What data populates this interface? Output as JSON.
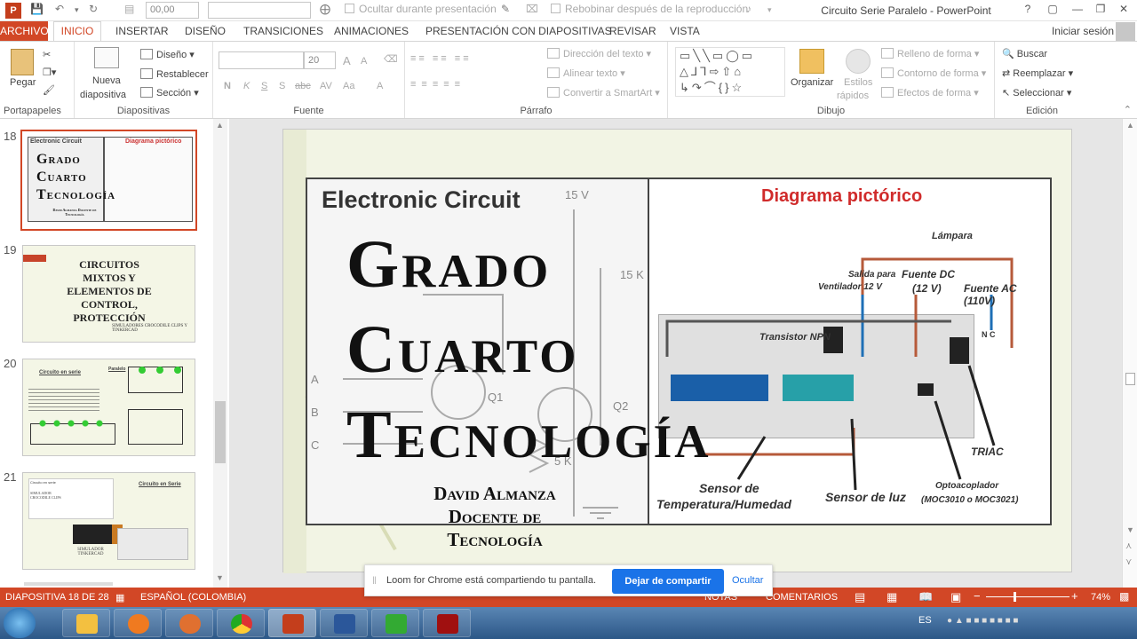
{
  "titlebar": {
    "app_icon_letter": "P",
    "font_size_value": "00,00",
    "hide_during_presentation": "Ocultar durante presentación",
    "rewind_after_playback": "Rebobinar después de la reproducción",
    "document_title": "Circuito Serie Paralelo - PowerPoint",
    "help": "?"
  },
  "tabs": {
    "archivo": "ARCHIVO",
    "inicio": "INICIO",
    "insertar": "INSERTAR",
    "diseno": "DISEÑO",
    "transiciones": "TRANSICIONES",
    "animaciones": "ANIMACIONES",
    "presentacion": "PRESENTACIÓN CON DIAPOSITIVAS",
    "revisar": "REVISAR",
    "vista": "VISTA",
    "signin": "Iniciar sesión"
  },
  "ribbon": {
    "portapapeles": {
      "label": "Portapapeles",
      "pegar": "Pegar"
    },
    "diapositivas": {
      "label": "Diapositivas",
      "nueva": "Nueva",
      "diapositiva": "diapositiva",
      "diseno": "Diseño",
      "restablecer": "Restablecer",
      "seccion": "Sección"
    },
    "fuente": {
      "label": "Fuente",
      "size": "20",
      "bold": "N",
      "italic": "K",
      "underline": "S",
      "shadow": "S",
      "strike": "abc",
      "spacing": "AV",
      "case": "Aa",
      "color": "A",
      "grow": "A",
      "shrink": "A"
    },
    "parrafo": {
      "label": "Párrafo",
      "direccion": "Dirección del texto",
      "alinear": "Alinear texto",
      "convertir": "Convertir a SmartArt"
    },
    "dibujo": {
      "label": "Dibujo",
      "organizar": "Organizar",
      "estilos": "Estilos",
      "rapidos": "rápidos",
      "relleno": "Relleno de forma",
      "contorno": "Contorno de forma",
      "efectos": "Efectos de forma"
    },
    "edicion": {
      "label": "Edición",
      "buscar": "Buscar",
      "reemplazar": "Reemplazar",
      "seleccionar": "Seleccionar"
    }
  },
  "thumbnails": [
    {
      "num": "18",
      "left_title": "Electronic Circuit",
      "right_title": "Diagrama pictórico",
      "big": [
        "Grado",
        "Cuarto",
        "Tecnología"
      ],
      "small": "David Almanza Docente de Tecnología"
    },
    {
      "num": "19",
      "lines": [
        "CIRCUITOS",
        "MIXTOS Y",
        "ELEMENTOS DE",
        "CONTROL,",
        "PROTECCIÓN"
      ],
      "sub": "SIMULADORES CROCODILE CLIPS Y TINKERCAD"
    },
    {
      "num": "20",
      "title": "Circuito en serie",
      "right": "Paralelo"
    },
    {
      "num": "21",
      "title": "Circuito en Serie",
      "left_top": "Circuito en serie",
      "sim1": "SIMULADOR CROCODILE CLIPS",
      "sim2": "SIMULADOR TINKERCAD"
    }
  ],
  "slide": {
    "left_title": "Electronic Circuit",
    "right_title": "Diagrama pictórico",
    "big_lines": [
      "Grado",
      "Cuarto",
      "Tecnología"
    ],
    "author_lines": [
      "David Almanza",
      "Docente de",
      "Tecnología"
    ],
    "circuit_labels": {
      "v15": "15 V",
      "r15k": "15 K",
      "r5k": "5 K",
      "q1": "Q1",
      "q2": "Q2",
      "a": "A",
      "b": "B",
      "c": "C"
    },
    "diagram_labels": {
      "lampara": "Lámpara",
      "salida": "Salida para",
      "ventilador": "Ventilador 12 V",
      "fuente_dc": "Fuente DC",
      "v12": "(12 V)",
      "fuente_ac": "Fuente AC (110V)",
      "transistor": "Transistor NPN",
      "sensor_temp1": "Sensor de",
      "sensor_temp2": "Temperatura/Humedad",
      "sensor_luz": "Sensor de luz",
      "opto1": "Optoacoplador",
      "opto2": "(MOC3010 o MOC3021)",
      "triac": "TRIAC",
      "nc": "N   C"
    }
  },
  "loom": {
    "message": "Loom for Chrome está compartiendo tu pantalla.",
    "stop": "Dejar de compartir",
    "hide": "Ocultar"
  },
  "status": {
    "slide": "DIAPOSITIVA 18 DE 28",
    "language": "ESPAÑOL (COLOMBIA)",
    "notas": "NOTAS",
    "comentarios": "COMENTARIOS",
    "zoom": "74%",
    "minus": "−",
    "plus": "+"
  },
  "taskbar": {
    "lang": "ES"
  }
}
